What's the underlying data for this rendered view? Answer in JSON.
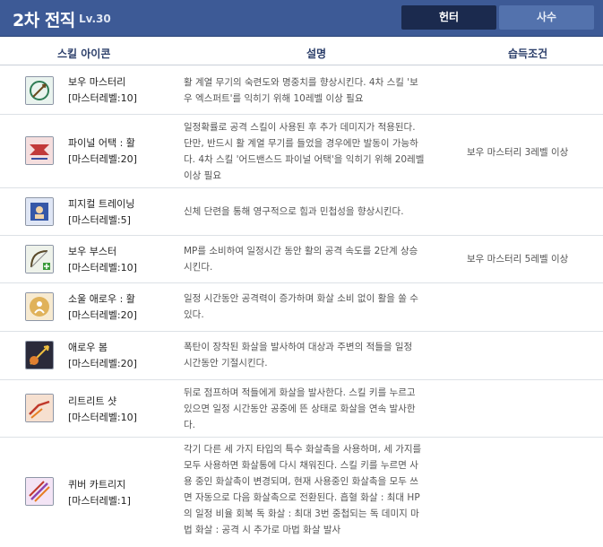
{
  "header": {
    "title": "2차 전직",
    "level": "Lv.30",
    "tabs": [
      {
        "label": "헌터",
        "active": true
      },
      {
        "label": "사수",
        "active": false
      }
    ],
    "colors": {
      "bar": "#3d5a96",
      "active_tab": "#1b2a4e",
      "inactive_tab": "#5372ad"
    }
  },
  "columns": {
    "icon": "스킬 아이콘",
    "desc": "설명",
    "cond": "습득조건"
  },
  "skills": [
    {
      "name": "보우 마스터리",
      "mastery": "[마스터레벨:10]",
      "icon": "bow-mastery-icon",
      "desc": [
        "활 계열 무기의 숙련도와 명중치를 향상시킨다. 4차 스킬 '보",
        "우 엑스퍼트'를 익히기 위해 10레벨 이상 필요"
      ],
      "cond": ""
    },
    {
      "name": "파이널 어택 : 활",
      "mastery": "[마스터레벨:20]",
      "icon": "final-attack-icon",
      "desc": [
        "일정확률로 공격 스킬이 사용된 후 추가 데미지가 적용된다.",
        "단만, 반드시 활 계열 무기를 들었을 경우에만 발동이 가능하",
        "다. 4차 스킬 '어드밴스드 파이널 어택'을 익히기 위해 20레벨",
        "이상 필요"
      ],
      "cond": "보우 마스터리 3레벨 이상"
    },
    {
      "name": "피지컬 트레이닝",
      "mastery": "[마스터레벨:5]",
      "icon": "physical-training-icon",
      "desc": [
        "신체 단련을 통해 영구적으로 힘과 민첩성을 향상시킨다."
      ],
      "cond": ""
    },
    {
      "name": "보우 부스터",
      "mastery": "[마스터레벨:10]",
      "icon": "bow-booster-icon",
      "desc": [
        "MP를 소비하여 일정시간 동안 활의 공격 속도를 2단계 상승",
        "시킨다."
      ],
      "cond": "보우 마스터리 5레벨 이상"
    },
    {
      "name": "소울 애로우 : 활",
      "mastery": "[마스터레벨:20]",
      "icon": "soul-arrow-icon",
      "desc": [
        "일정 시간동안 공격력이 증가하며 화살 소비 없이 활을 쏠 수",
        "있다."
      ],
      "cond": ""
    },
    {
      "name": "애로우 봄",
      "mastery": "[마스터레벨:20]",
      "icon": "arrow-bomb-icon",
      "desc": [
        "폭탄이 장착된 화살을 발사하여 대상과 주변의 적들을 일정",
        "시간동안 기절시킨다."
      ],
      "cond": ""
    },
    {
      "name": "리트리트 샷",
      "mastery": "[마스터레벨:10]",
      "icon": "retreat-shot-icon",
      "desc": [
        "뒤로 점프하며 적들에게 화살을 발사한다. 스킬 키를 누르고",
        "있으면 일정 시간동안 공중에 뜬 상태로 화살을 연속 발사한",
        "다."
      ],
      "cond": ""
    },
    {
      "name": "퀴버 카트리지",
      "mastery": "[마스터레벨:1]",
      "icon": "quiver-cartridge-icon",
      "desc": [
        "각기 다른 세 가지 타입의 특수 화살촉을 사용하며, 세 가지를",
        "모두 사용하면 화살통에 다시 채워진다. 스킬 키를 누르면 사",
        "용 중인 화살촉이 변경되며, 현재 사용중인 화살촉을 모두 쓰",
        "면 자동으로 다음 화살촉으로 전환된다. 흡혈 화살 : 최대 HP",
        "의 일정 비율 회복 독 화살 : 최대 3번 중첩되는 독 데미지 마",
        "법 화살 : 공격 시 추가로 마법 화살 발사"
      ],
      "cond": ""
    }
  ]
}
